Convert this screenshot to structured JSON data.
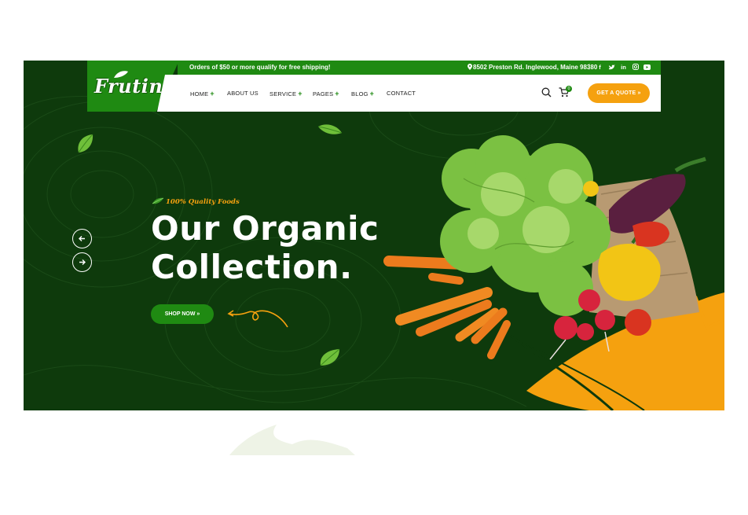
{
  "brand": {
    "name": "Frutin"
  },
  "topbar": {
    "promo": "Orders of $50 or more qualify for free shipping!",
    "address": "8502 Preston Rd. Inglewood, Maine 98380",
    "separator": "|",
    "socials": [
      "facebook-icon",
      "twitter-icon",
      "linkedin-icon",
      "instagram-icon",
      "youtube-icon"
    ]
  },
  "nav": {
    "items": [
      {
        "label": "HOME",
        "has_submenu": true
      },
      {
        "label": "ABOUT US",
        "has_submenu": false
      },
      {
        "label": "SERVICE",
        "has_submenu": true
      },
      {
        "label": "PAGES",
        "has_submenu": true
      },
      {
        "label": "BLOG",
        "has_submenu": true
      },
      {
        "label": "CONTACT",
        "has_submenu": false
      }
    ],
    "plus_symbol": "+",
    "cart_count": "0",
    "quote_label": "GET A QUOTE »"
  },
  "hero": {
    "tagline": "100% Quality Foods",
    "headline_line1": "Our Organic",
    "headline_line2": "Collection.",
    "cta_label": "SHOP NOW »"
  },
  "colors": {
    "hero_bg": "#0e3a0c",
    "brand_green": "#1f8a12",
    "accent_orange": "#f5a10f",
    "white": "#ffffff"
  }
}
